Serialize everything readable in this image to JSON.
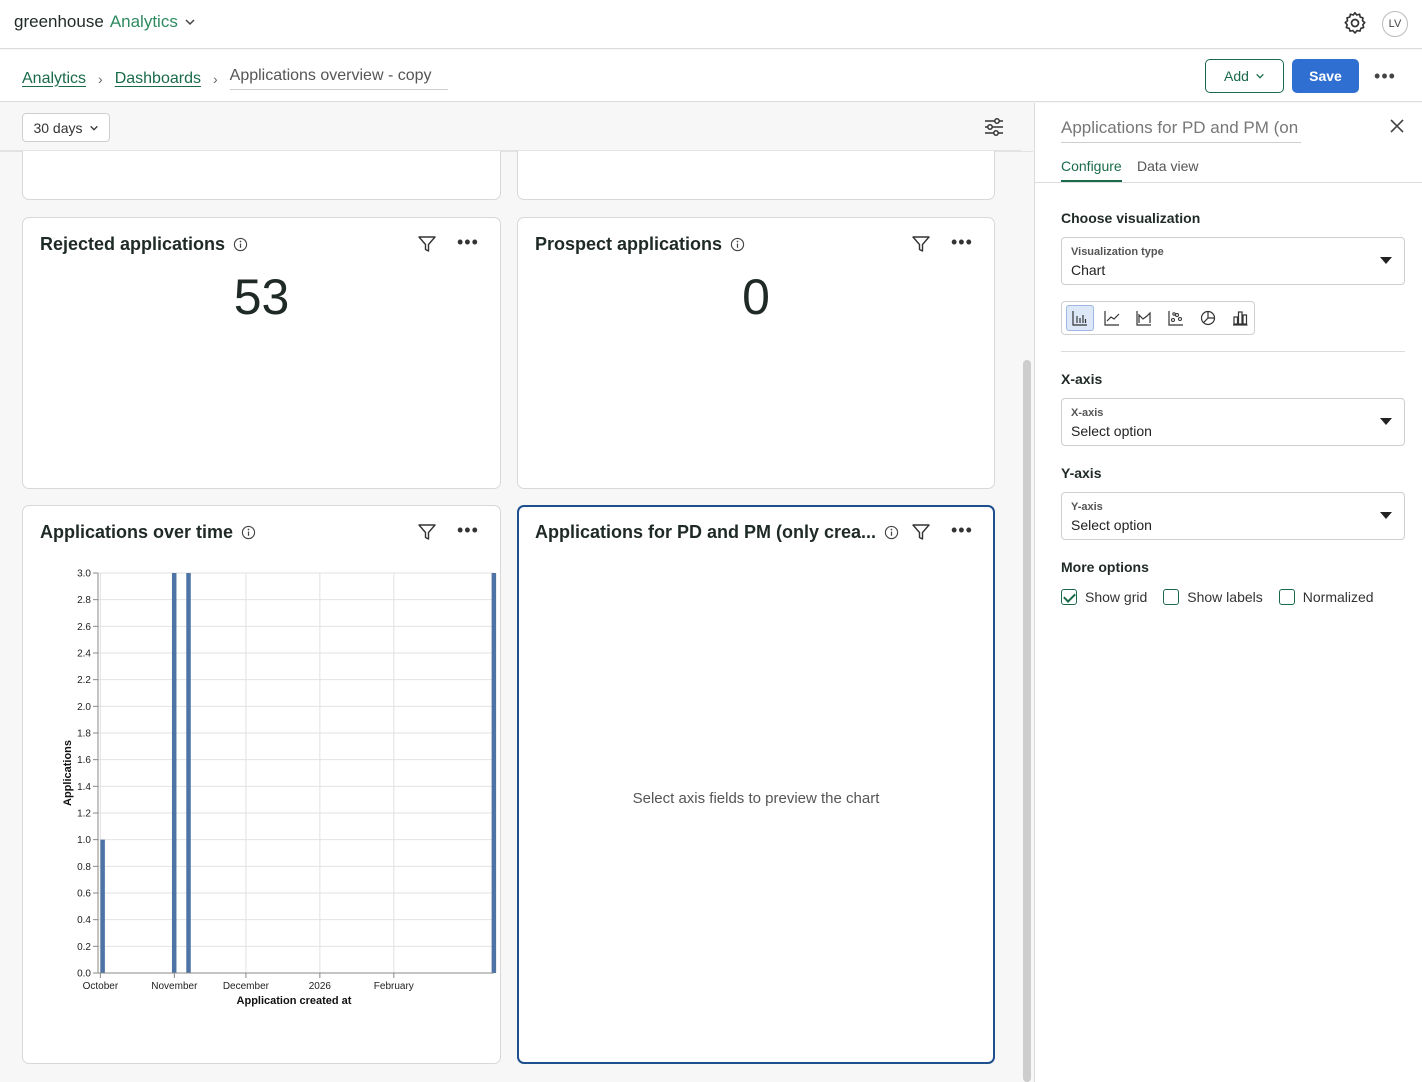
{
  "app": {
    "brand_prefix": "greenhouse",
    "brand_suffix": "Analytics",
    "user_initials": "LV"
  },
  "breadcrumb": {
    "root": "Analytics",
    "section": "Dashboards",
    "current": "Applications overview - copy"
  },
  "toolbar": {
    "add_label": "Add",
    "save_label": "Save"
  },
  "filters": {
    "date_range": "30 days"
  },
  "cards": {
    "rejected": {
      "title": "Rejected applications",
      "value": "53"
    },
    "prospect": {
      "title": "Prospect applications",
      "value": "0"
    },
    "over_time": {
      "title": "Applications over time"
    },
    "pd_pm": {
      "title": "Applications for PD and PM (only crea...",
      "empty_message": "Select axis fields to preview the chart"
    }
  },
  "panel": {
    "title": "Applications for PD and PM (on",
    "tabs": [
      "Configure",
      "Data view"
    ],
    "choose_visualization_label": "Choose visualization",
    "viz_type": {
      "label": "Visualization type",
      "value": "Chart"
    },
    "viz_icons": [
      "bar-chart-icon",
      "line-chart-icon",
      "area-chart-icon",
      "scatter-chart-icon",
      "pie-chart-icon",
      "column-chart-icon"
    ],
    "x_axis": {
      "section": "X-axis",
      "label": "X-axis",
      "value": "Select option"
    },
    "y_axis": {
      "section": "Y-axis",
      "label": "Y-axis",
      "value": "Select option"
    },
    "more_options_label": "More options",
    "options": [
      {
        "label": "Show grid",
        "checked": true
      },
      {
        "label": "Show labels",
        "checked": false
      },
      {
        "label": "Normalized",
        "checked": false
      }
    ]
  },
  "colors": {
    "accent": "#1a6b4a",
    "primary": "#2f6fd1",
    "bar": "#4e74a5"
  },
  "chart_data": {
    "type": "bar",
    "xlabel": "Application created at",
    "ylabel": "Applications",
    "ylim": [
      0,
      3.0
    ],
    "y_ticks": [
      0.0,
      0.2,
      0.4,
      0.6,
      0.8,
      1.0,
      1.2,
      1.4,
      1.6,
      1.8,
      2.0,
      2.2,
      2.4,
      2.6,
      2.8,
      3.0
    ],
    "x_ticks": [
      "October",
      "November",
      "December",
      "2026",
      "February"
    ],
    "x_range": [
      "2025-09-30",
      "2026-03-15"
    ],
    "x_tick_dates": [
      "2025-10-01",
      "2025-11-01",
      "2025-12-01",
      "2026-01-01",
      "2026-02-01"
    ],
    "points": [
      {
        "x": "2025-10-01",
        "y": 1.0
      },
      {
        "x": "2025-10-31",
        "y": 3.0
      },
      {
        "x": "2025-11-06",
        "y": 3.0
      },
      {
        "x": "2026-03-14",
        "y": 3.0
      }
    ],
    "grid": true
  }
}
